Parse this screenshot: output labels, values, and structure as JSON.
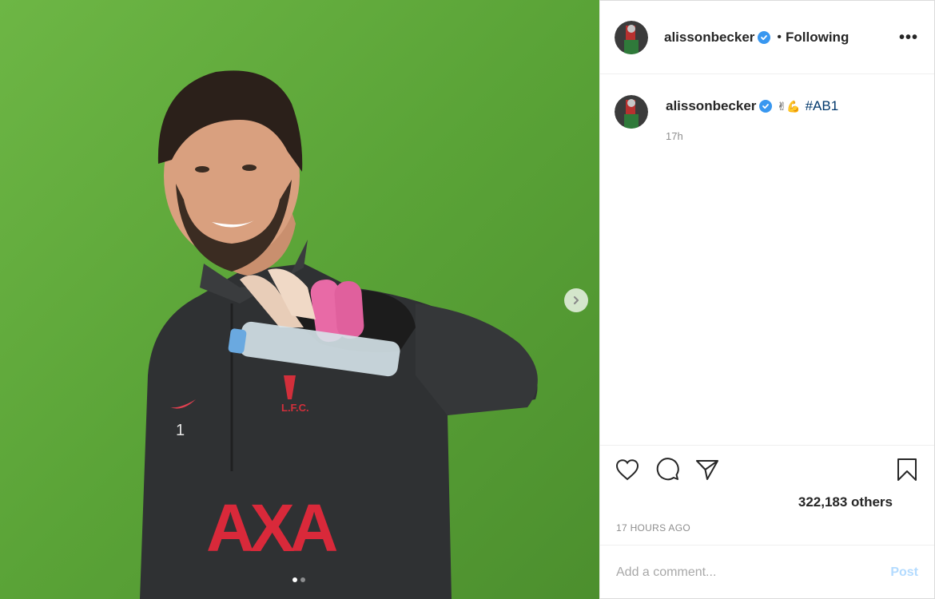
{
  "post": {
    "username": "alissonbecker",
    "follow_status": "Following",
    "more_label": "•••",
    "caption_emoji": "✌💪",
    "caption_hashtag": "#AB1",
    "caption_time": "17h",
    "likes_text": "322,183 others",
    "timestamp": "17 HOURS AGO",
    "image_count": 2,
    "active_image_index": 0
  },
  "comment_box": {
    "placeholder": "Add a comment...",
    "post_label": "Post"
  },
  "icons": {
    "like": "heart-icon",
    "comment": "comment-bubble-icon",
    "share": "paper-plane-icon",
    "save": "bookmark-icon",
    "next": "chevron-right-icon",
    "verified": "verified-badge-icon"
  },
  "colors": {
    "verified_blue": "#3897f0",
    "hashtag": "#00376b",
    "post_disabled": "#b3dbff",
    "muted_text": "#8e8e8e"
  }
}
